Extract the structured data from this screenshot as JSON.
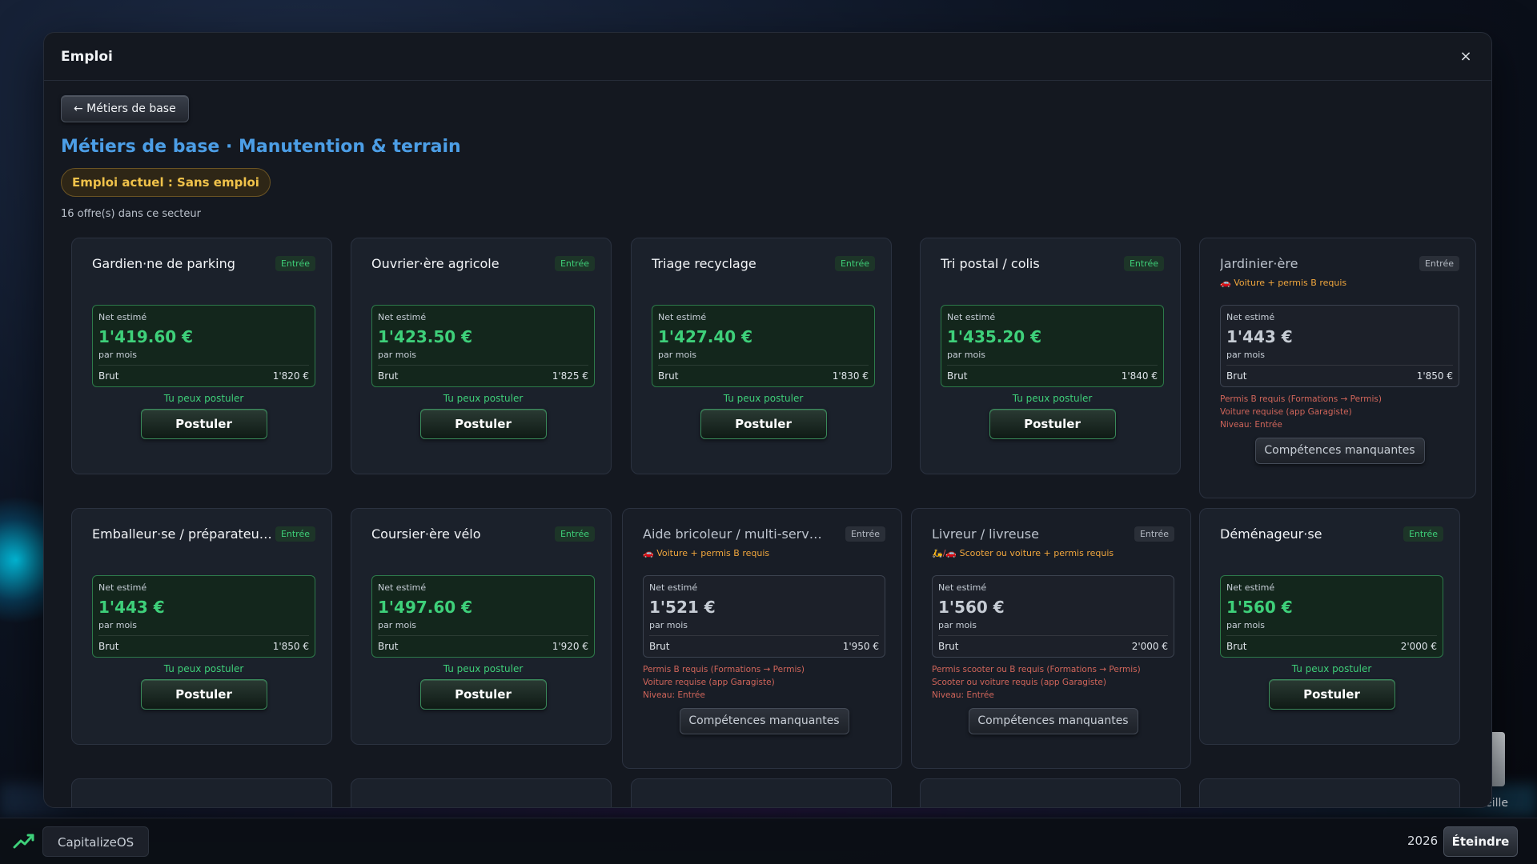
{
  "window": {
    "title": "Emploi",
    "close_label": "×"
  },
  "back_label": "← Métiers de base",
  "section_title": "Métiers de base · Manutention & terrain",
  "current_job": "Emploi actuel : Sans emploi",
  "offers_count": "16 offre(s) dans ce secteur",
  "labels": {
    "net": "Net estimé",
    "per_month": "par mois",
    "brut": "Brut",
    "can_apply": "Tu peux postuler",
    "apply": "Postuler",
    "missing": "Compétences manquantes"
  },
  "jobs": [
    {
      "title": "Gardien·ne de parking",
      "badge": "Entrée",
      "eligible": true,
      "requirement": "",
      "net": "1'419.60 €",
      "brut": "1'820 €",
      "missing": []
    },
    {
      "title": "Ouvrier·ère agricole",
      "badge": "Entrée",
      "eligible": true,
      "requirement": "",
      "net": "1'423.50 €",
      "brut": "1'825 €",
      "missing": []
    },
    {
      "title": "Triage recyclage",
      "badge": "Entrée",
      "eligible": true,
      "requirement": "",
      "net": "1'427.40 €",
      "brut": "1'830 €",
      "missing": []
    },
    {
      "title": "Tri postal / colis",
      "badge": "Entrée",
      "eligible": true,
      "requirement": "",
      "net": "1'435.20 €",
      "brut": "1'840 €",
      "missing": []
    },
    {
      "title": "Jardinier·ère",
      "badge": "Entrée",
      "eligible": false,
      "requirement_icon": "🚗",
      "requirement": "Voiture + permis B requis",
      "net": "1'443 €",
      "brut": "1'850 €",
      "missing": [
        "Permis B requis (Formations → Permis)",
        "Voiture requise (app Garagiste)",
        "Niveau: Entrée"
      ]
    },
    {
      "title": "Emballeur·se / préparateur·...",
      "badge": "Entrée",
      "eligible": true,
      "requirement": "",
      "net": "1'443 €",
      "brut": "1'850 €",
      "missing": []
    },
    {
      "title": "Coursier·ère vélo",
      "badge": "Entrée",
      "eligible": true,
      "requirement": "",
      "net": "1'497.60 €",
      "brut": "1'920 €",
      "missing": []
    },
    {
      "title": "Aide bricoleur / multi-services",
      "badge": "Entrée",
      "eligible": false,
      "requirement_icon": "🚗",
      "requirement": "Voiture + permis B requis",
      "net": "1'521 €",
      "brut": "1'950 €",
      "missing": [
        "Permis B requis (Formations → Permis)",
        "Voiture requise (app Garagiste)",
        "Niveau: Entrée"
      ]
    },
    {
      "title": "Livreur / livreuse",
      "badge": "Entrée",
      "eligible": false,
      "requirement_icon": "🛵/🚗",
      "requirement": "Scooter ou voiture + permis requis",
      "net": "1'560 €",
      "brut": "2'000 €",
      "missing": [
        "Permis scooter ou B requis (Formations → Permis)",
        "Scooter ou voiture requis (app Garagiste)",
        "Niveau: Entrée"
      ]
    },
    {
      "title": "Déménageur·se",
      "badge": "Entrée",
      "eligible": true,
      "requirement": "",
      "net": "1'560 €",
      "brut": "2'000 €",
      "missing": []
    }
  ],
  "taskbar": {
    "app_label": "CapitalizeOS",
    "year": "2026",
    "power_label": "Éteindre"
  },
  "desktop": {
    "trash_label": "eille"
  },
  "colors": {
    "accent_blue": "#4c9ee6",
    "success_green": "#3ed07a",
    "warning_orange": "#f0a63d",
    "error_red": "#d0655a",
    "badge_gold": "#f0c24a"
  }
}
